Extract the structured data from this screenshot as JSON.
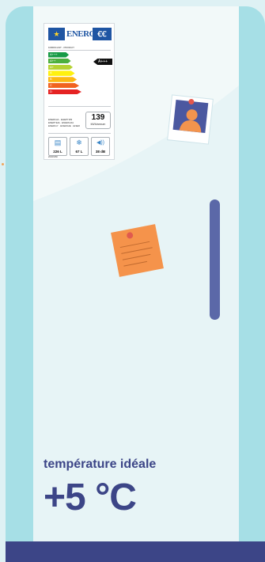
{
  "energy_label": {
    "brand": "ENERG",
    "brand_suffix": "ꞒꞒ",
    "flag": "★",
    "maker": "FABRICANT - PRODUIT",
    "bars": [
      "A+++",
      "A++",
      "A+",
      "A",
      "B",
      "C",
      "D"
    ],
    "bar_colors": [
      "#179b46",
      "#4caf3e",
      "#b6d233",
      "#fff10f",
      "#fcb813",
      "#f1631f",
      "#e52323"
    ],
    "rating": "A+++",
    "codes": [
      "ENERGIA · ЕНЕРГИЯ",
      "ΕΝΕΡΓΕΙΑ · ENERGIJA",
      "ENERGY · ENERGIE · ENERGI"
    ],
    "consumption_value": "139",
    "consumption_unit": "kWh/annum",
    "icons": [
      {
        "icon": "fridge-icon",
        "glyph": "▤",
        "value": "226 L"
      },
      {
        "icon": "snowflake-icon",
        "glyph": "❄",
        "value": "67 L"
      },
      {
        "icon": "speaker-icon",
        "glyph": "◀))",
        "value": "38 dB"
      }
    ],
    "footer": "2010/1060"
  },
  "temperature": {
    "caption": "température idéale",
    "value": "+5 °C"
  },
  "colors": {
    "fridge_body": "#a6dfe6",
    "door": "#f2f9f9",
    "accent": "#3c4587",
    "handle": "#5b68a8",
    "note": "#f5934b",
    "photo_bg": "#4b58a0"
  }
}
